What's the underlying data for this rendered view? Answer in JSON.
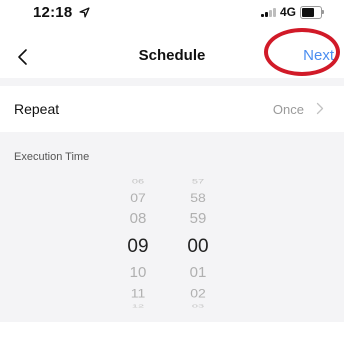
{
  "status_bar": {
    "time": "12:18",
    "network": "4G",
    "location_icon": "location-arrow-icon",
    "signal_icon": "signal-icon",
    "battery_icon": "battery-icon"
  },
  "nav": {
    "back_icon": "chevron-left-icon",
    "title": "Schedule",
    "next_label": "Next",
    "next_color": "#4a8df0",
    "highlight_color": "#d11a28"
  },
  "repeat": {
    "label": "Repeat",
    "value": "Once",
    "chevron_icon": "chevron-right-icon"
  },
  "execution_time": {
    "header": "Execution Time"
  },
  "picker": {
    "hours": [
      "06",
      "07",
      "08",
      "09",
      "10",
      "11",
      "12"
    ],
    "minutes": [
      "57",
      "58",
      "59",
      "00",
      "01",
      "02",
      "03"
    ],
    "selected_hour": "09",
    "selected_minute": "00"
  }
}
